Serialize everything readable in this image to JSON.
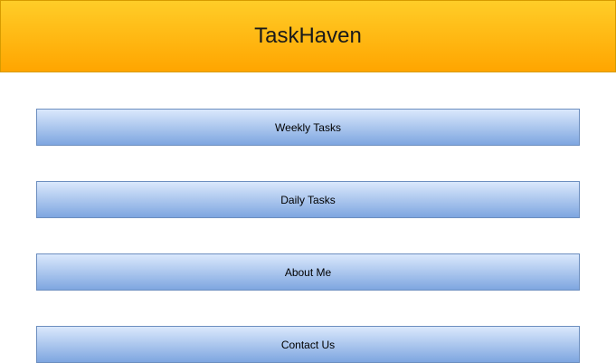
{
  "header": {
    "title": "TaskHaven"
  },
  "nav": {
    "items": [
      {
        "label": "Weekly Tasks"
      },
      {
        "label": "Daily Tasks"
      },
      {
        "label": "About Me"
      },
      {
        "label": "Contact Us"
      }
    ]
  },
  "colors": {
    "header_gradient_top": "#ffcd28",
    "header_gradient_bottom": "#ffa500",
    "header_border": "#d79b00",
    "button_gradient_top": "#dae8fc",
    "button_gradient_bottom": "#7ea6e0",
    "button_border": "#6c8ebf"
  }
}
